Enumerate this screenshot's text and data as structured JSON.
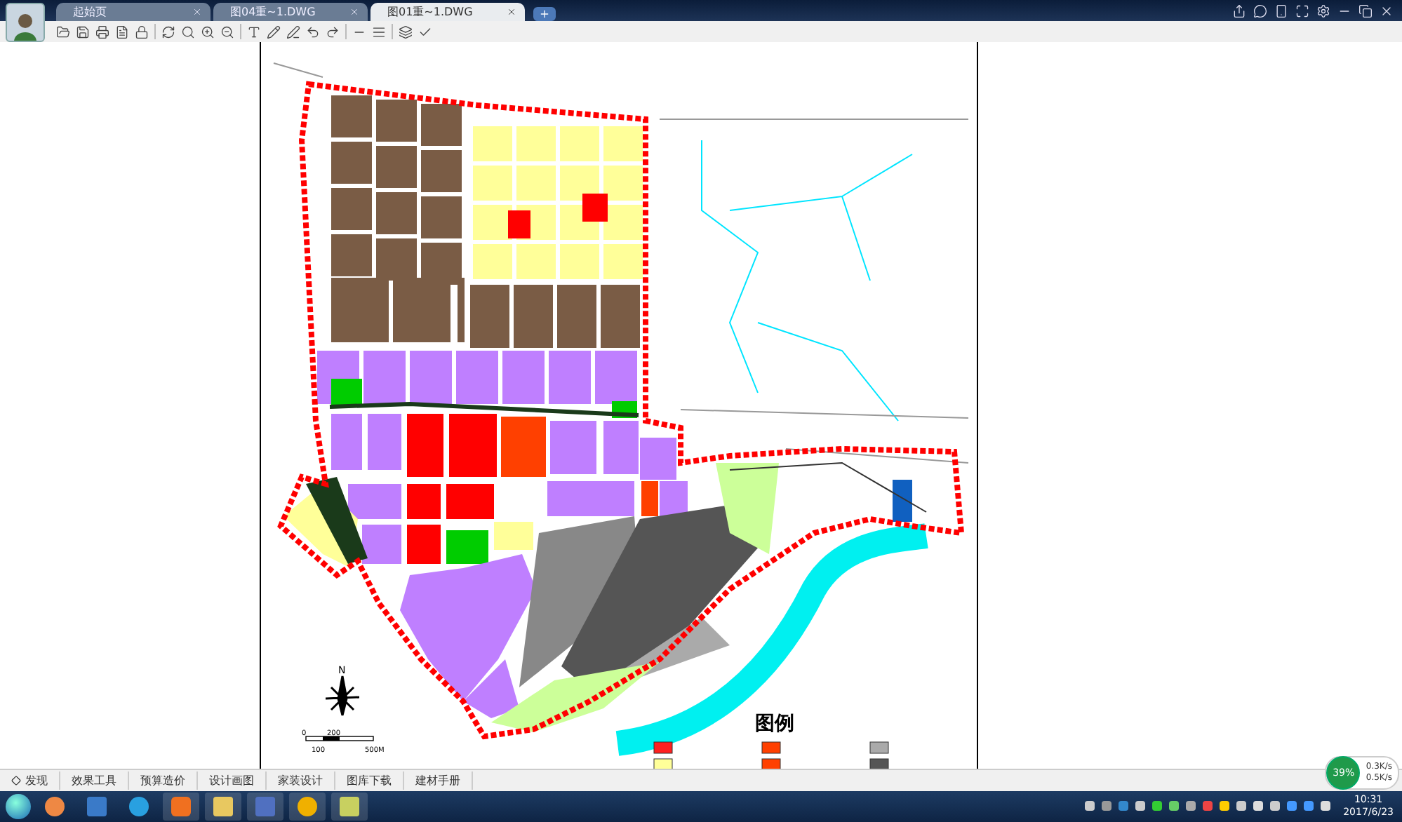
{
  "tabs": [
    {
      "label": "起始页",
      "selected": false
    },
    {
      "label": "图04重~1.DWG",
      "selected": false
    },
    {
      "label": "图01重~1.DWG",
      "selected": true
    }
  ],
  "drawing": {
    "legend_title": "图例",
    "north_label": "N",
    "scale_labels": [
      "0",
      "200",
      "100",
      "500M"
    ]
  },
  "bottom_tabs": [
    {
      "label": "发现",
      "selected": false
    },
    {
      "label": "效果工具",
      "selected": false
    },
    {
      "label": "预算造价",
      "selected": false
    },
    {
      "label": "设计画图",
      "selected": false
    },
    {
      "label": "家装设计",
      "selected": false
    },
    {
      "label": "图库下载",
      "selected": false
    },
    {
      "label": "建材手册",
      "selected": false
    }
  ],
  "network_widget": {
    "usage": "39%",
    "upload": "0.3K/s",
    "download": "0.5K/s"
  },
  "clock": {
    "time": "10:31",
    "date": "2017/6/23"
  }
}
